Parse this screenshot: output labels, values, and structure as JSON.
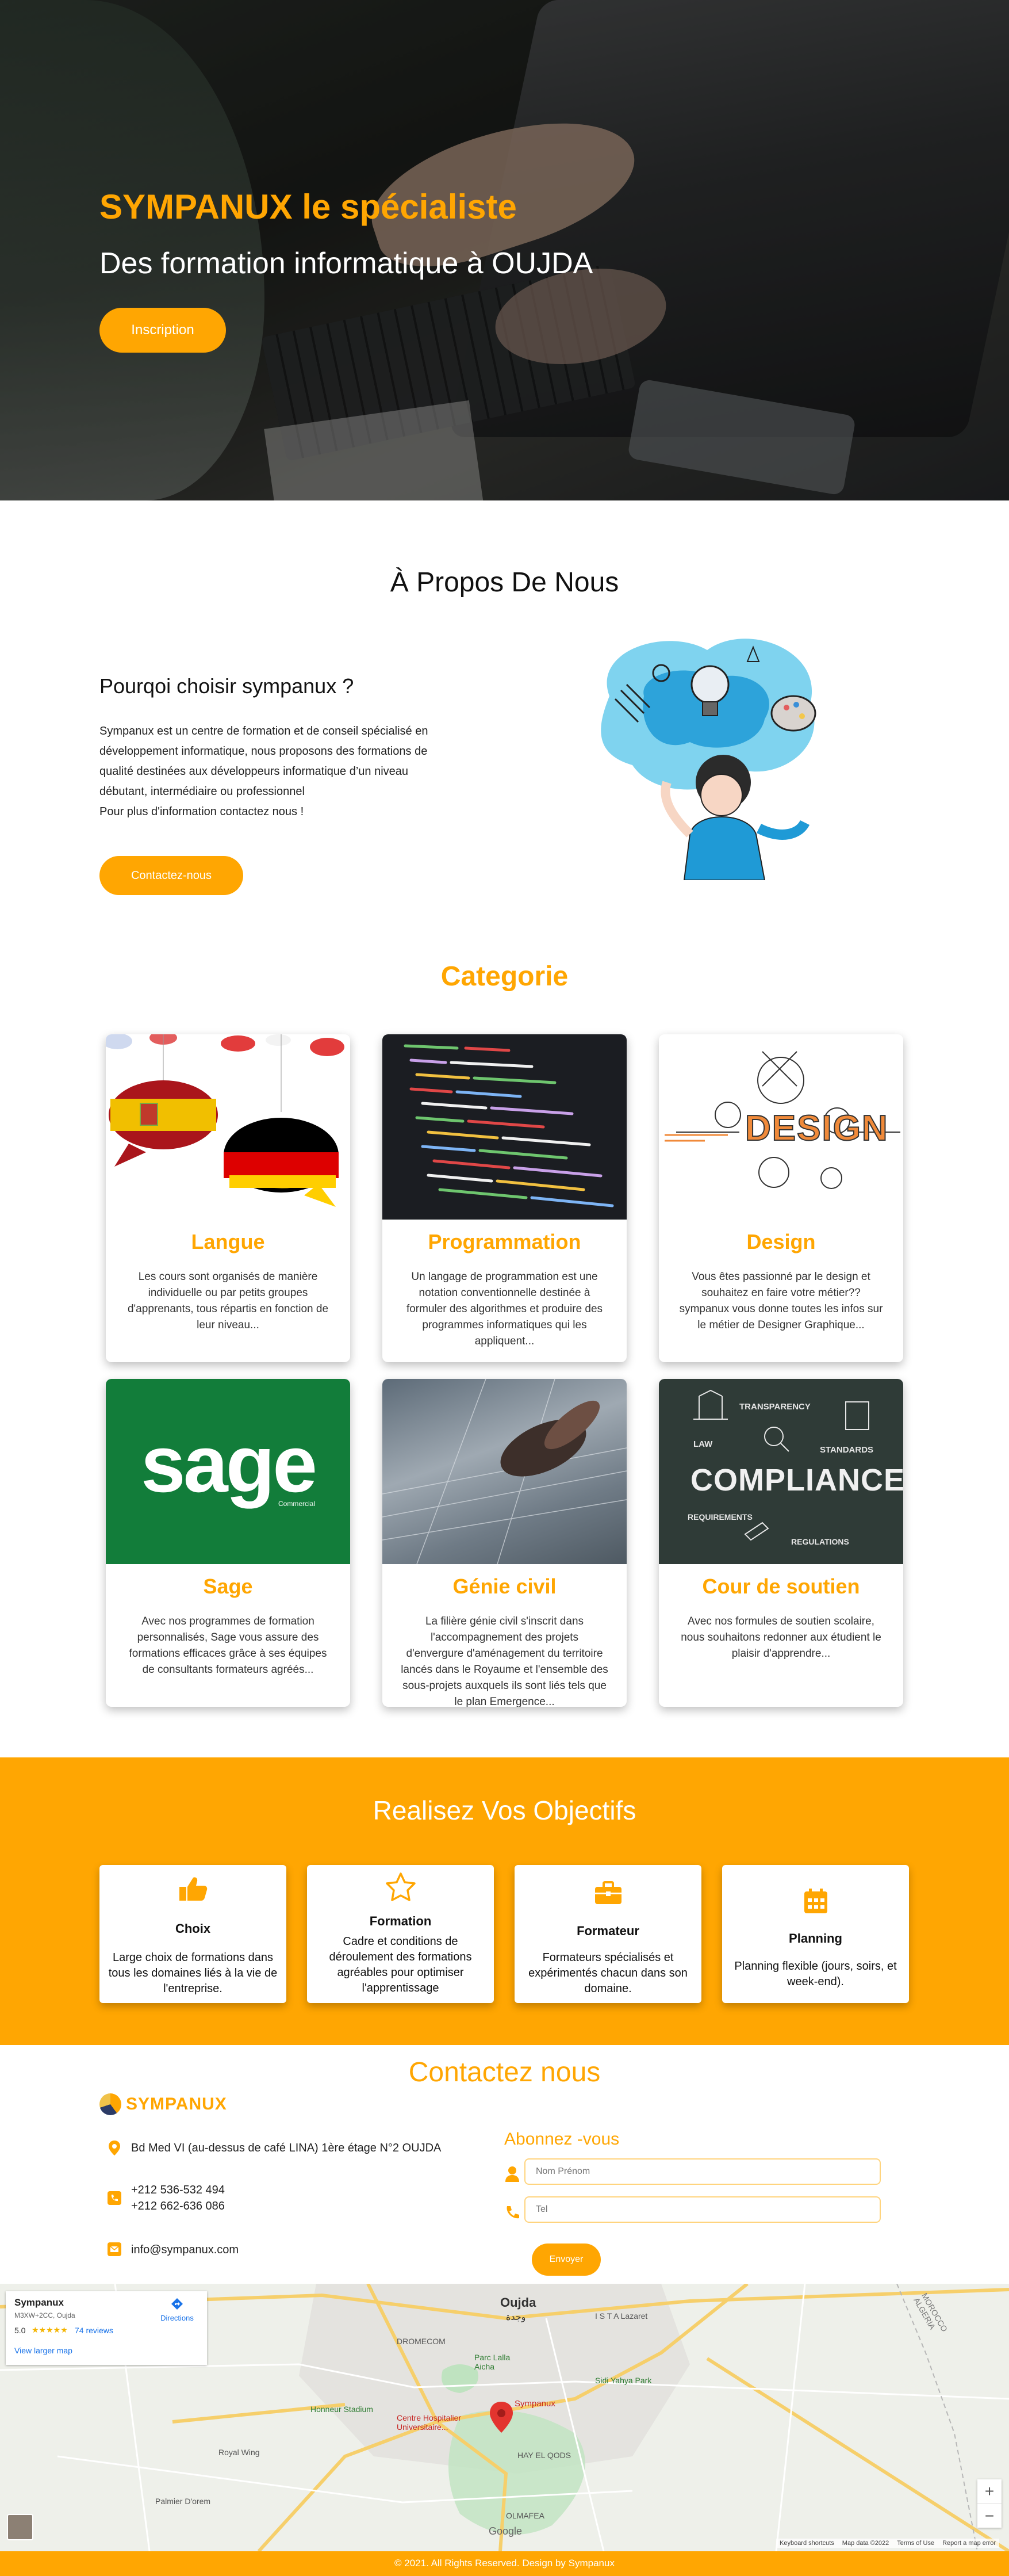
{
  "hero": {
    "title": "SYMPANUX le spécialiste",
    "subtitle": "Des formation informatique à OUJDA",
    "button": "Inscription"
  },
  "about": {
    "section_title": "À Propos De Nous",
    "heading": "Pourqoi choisir sympanux ?",
    "paragraph_lines": [
      "Sympanux est un centre de formation et de conseil spécialisé en",
      "développement informatique, nous proposons des formations de",
      "qualité destinées aux développeurs informatique d’un niveau",
      "débutant, intermédiaire ou professionnel",
      "Pour plus d'information contactez nous !"
    ],
    "button": "Contactez-nous"
  },
  "categories": {
    "section_title": "Categorie",
    "cards": [
      {
        "title": "Langue",
        "lines": [
          "Les cours sont organisés de manière",
          "individuelle ou par petits groupes",
          "d'apprenants, tous répartis en fonction de",
          "leur niveau..."
        ]
      },
      {
        "title": "Programmation",
        "lines": [
          "Un langage de programmation est une",
          "notation conventionnelle destinée à",
          "formuler des algorithmes et produire des",
          "programmes informatiques qui les",
          "appliquent..."
        ]
      },
      {
        "title": "Design",
        "lines": [
          "Vous êtes passionné par le design et",
          "souhaitez en faire votre métier??",
          "sympanux vous donne toutes les infos sur",
          "le métier de Designer Graphique..."
        ]
      },
      {
        "title": "Sage",
        "lines": [
          "Avec nos programmes de formation",
          "personnalisés, Sage vous assure des",
          "formations efficaces grâce à ses équipes",
          "de consultants formateurs agréés..."
        ]
      },
      {
        "title": "Génie civil",
        "lines": [
          "La filière génie civil s'inscrit dans",
          "l'accompagnement des projets",
          "d'envergure d'aménagement du territoire",
          "lancés dans le Royaume et l'ensemble des",
          "sous-projets auxquels ils sont liés tels que",
          "le plan Emergence..."
        ]
      },
      {
        "title": "Cour de soutien",
        "lines": [
          "Avec nos formules de soutien scolaire,",
          "nous souhaitons redonner aux étudient le",
          "plaisir d'apprendre..."
        ]
      }
    ],
    "image_texts": {
      "design": "DESIGN",
      "sage": "sage",
      "sage_small": "Commercial",
      "compliance": "COMPLIANCE",
      "transparency": "TRANSPARENCY",
      "law": "LAW",
      "standards": "STANDARDS",
      "requirements": "REQUIREMENTS",
      "regulations": "REGULATIONS"
    }
  },
  "objectives": {
    "section_title": "Realisez Vos Objectifs",
    "cards": [
      {
        "icon": "thumbs-up-icon",
        "title": "Choix",
        "lines": [
          "Large choix de formations dans",
          "tous les domaines liés à la vie de",
          "l'entreprise."
        ]
      },
      {
        "icon": "star-icon",
        "title": "Formation",
        "lines": [
          "Cadre et conditions de",
          "déroulement des formations",
          "agréables pour optimiser",
          "l'apprentissage"
        ]
      },
      {
        "icon": "briefcase-icon",
        "title": "Formateur",
        "lines": [
          "Formateurs spécialisés et",
          "expérimentés chacun dans son",
          "domaine."
        ]
      },
      {
        "icon": "calendar-icon",
        "title": "Planning",
        "lines": [
          "Planning flexible (jours, soirs, et",
          "week-end)."
        ]
      }
    ]
  },
  "contact": {
    "section_title": "Contactez nous",
    "logo_text": "SYMPANUX",
    "address": "Bd Med VI (au-dessus de café LINA) 1ère étage N°2 OUJDA",
    "phone1": "+212 536-532 494",
    "phone2": "+212 662-636 086",
    "email": "info@sympanux.com",
    "subscribe_title": "Abonnez -vous",
    "name_placeholder": "Nom Prénom",
    "tel_placeholder": "Tel",
    "send_button": "Envoyer"
  },
  "map": {
    "place_name": "Sympanux",
    "place_address": "M3XW+2CC, Oujda",
    "rating": "5.0",
    "stars": "★★★★★",
    "reviews": "74 reviews",
    "directions": "Directions",
    "larger_map": "View larger map",
    "marker_label": "Sympanux",
    "labels": {
      "oujda": "Oujda",
      "oujda_ar": "وجدة",
      "lazaret": "I S T A Lazaret",
      "dromecom": "DROMECOM",
      "parc": "Parc Lalla Aicha",
      "sidi_yahya": "Sidi Yahya Park",
      "stadium": "Honneur Stadium",
      "hospital": "Centre Hospitalier Universitaire...",
      "hay_el_qods": "HAY EL QODS",
      "royal_wing": "Royal Wing",
      "palmier": "Palmier D'orem",
      "olmafea": "OLMAFEA",
      "algeria": "MOROCCO ALGERIA",
      "google": "Google"
    },
    "attribution": [
      "Keyboard shortcuts",
      "Map data ©2022",
      "Terms of Use",
      "Report a map error"
    ]
  },
  "footer": {
    "text": "© 2021. All Rights Reserved. Design by Sympanux"
  },
  "colors": {
    "accent": "#ffa602",
    "white": "#ffffff"
  }
}
